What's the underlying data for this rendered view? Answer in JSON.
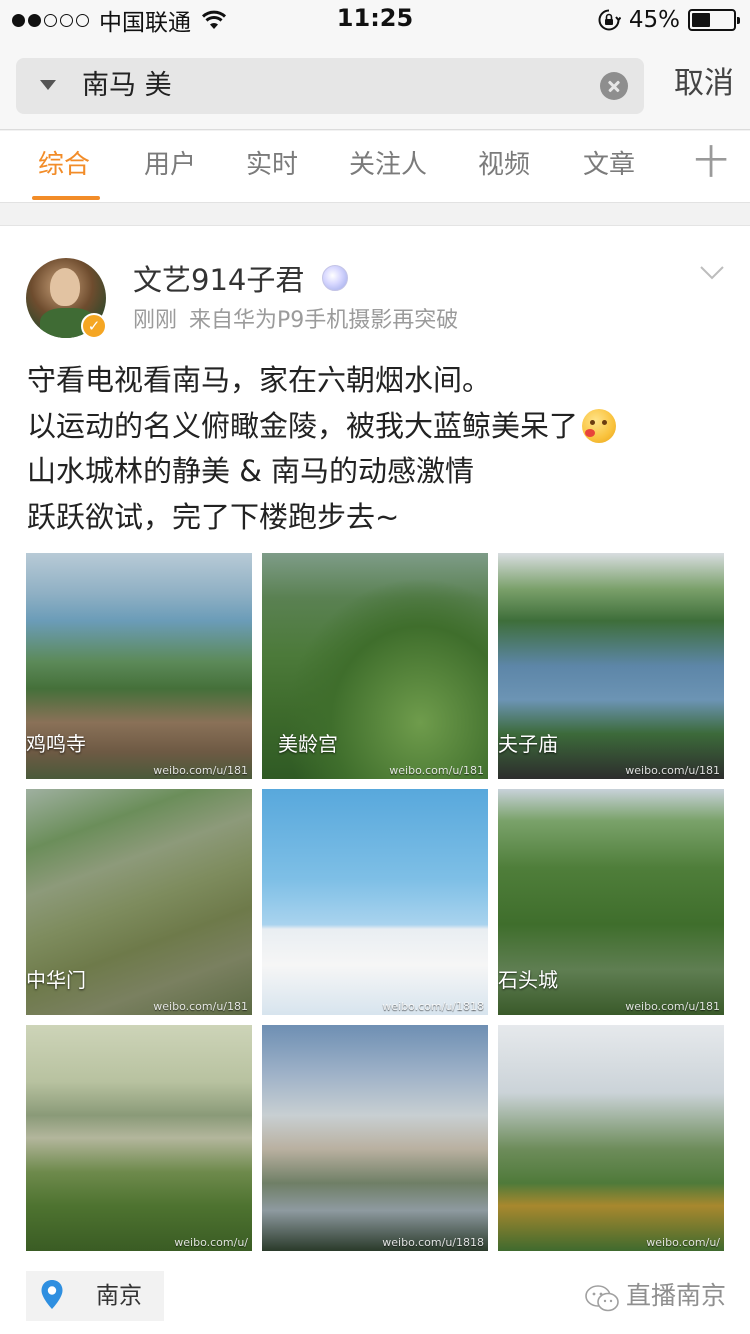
{
  "status_bar": {
    "carrier": "中国联通",
    "signal_strength": 2,
    "signal_max": 5,
    "time": "11:25",
    "battery_percent": "45%",
    "battery_level": 0.45
  },
  "search": {
    "query": "南马 美",
    "cancel_label": "取消"
  },
  "tabs": [
    {
      "label": "综合",
      "active": true
    },
    {
      "label": "用户",
      "active": false
    },
    {
      "label": "实时",
      "active": false
    },
    {
      "label": "关注人",
      "active": false
    },
    {
      "label": "视频",
      "active": false
    },
    {
      "label": "文章",
      "active": false
    }
  ],
  "tabs_more_label": "十",
  "post": {
    "author": "文艺914子君",
    "time": "刚刚",
    "source": "来自华为P9手机摄影再突破",
    "lines": [
      "守看电视看南马，家在六朝烟水间。",
      "以运动的名义俯瞰金陵，被我大蓝鲸美呆了",
      "山水城林的静美 & 南马的动感激情",
      "跃跃欲试，完了下楼跑步去~"
    ],
    "photos": [
      {
        "caption": "鸡鸣寺",
        "watermark": "weibo.com/u/181"
      },
      {
        "caption": "美龄宫",
        "watermark": "weibo.com/u/181"
      },
      {
        "caption": "夫子庙",
        "watermark": "weibo.com/u/181"
      },
      {
        "caption": "中华门",
        "watermark": "weibo.com/u/181"
      },
      {
        "caption": "",
        "watermark": "weibo.com/u/1818"
      },
      {
        "caption": "石头城",
        "watermark": "weibo.com/u/181"
      },
      {
        "caption": "",
        "watermark": "weibo.com/u/"
      },
      {
        "caption": "",
        "watermark": "weibo.com/u/1818"
      },
      {
        "caption": "",
        "watermark": "weibo.com/u/"
      }
    ],
    "location": "南京"
  },
  "footer_watermark": "直播南京",
  "colors": {
    "accent": "#f28c28",
    "verified": "#f5a623",
    "location_pin": "#2f8fe0"
  },
  "icons": [
    "wifi-icon",
    "orientation-lock-icon",
    "battery-icon",
    "dropdown-caret-icon",
    "clear-icon",
    "verified-icon",
    "member-icon",
    "chevron-down-icon",
    "emoji-icon",
    "location-pin-icon",
    "wechat-icon"
  ]
}
